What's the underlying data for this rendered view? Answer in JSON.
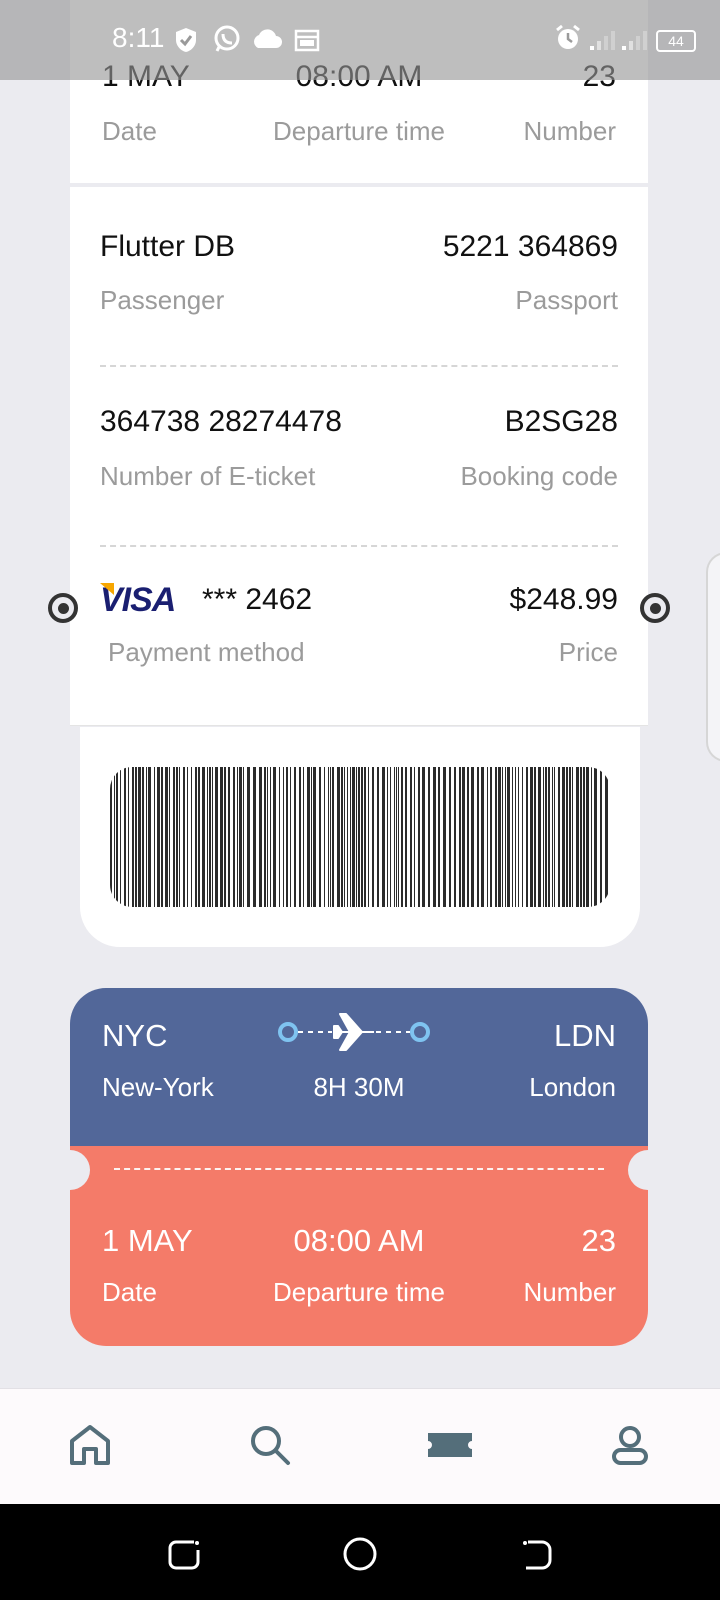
{
  "status_bar": {
    "time": "8:11",
    "battery": "44"
  },
  "top_ticket": {
    "date": "1 MAY",
    "date_label": "Date",
    "departure": "08:00 AM",
    "departure_label": "Departure time",
    "number": "23",
    "number_label": "Number"
  },
  "details": {
    "passenger": "Flutter DB",
    "passenger_label": "Passenger",
    "passport": "5221 364869",
    "passport_label": "Passport",
    "eticket": "364738 28274478",
    "eticket_label": "Number of E-ticket",
    "booking": "B2SG28",
    "booking_label": "Booking code",
    "visa_logo": "VISA",
    "card": "*** 2462",
    "payment_label": "Payment method",
    "price": "$248.99",
    "price_label": "Price"
  },
  "ticket": {
    "from_code": "NYC",
    "from_city": "New-York",
    "to_code": "LDN",
    "to_city": "London",
    "duration": "8H 30M",
    "date": "1 MAY",
    "date_label": "Date",
    "departure": "08:00 AM",
    "departure_label": "Departure time",
    "number": "23",
    "number_label": "Number"
  },
  "nav": [
    "home-icon",
    "search-icon",
    "ticket-icon",
    "profile-icon"
  ],
  "colors": {
    "ticket_top": "#526799",
    "ticket_bottom": "#f47b69",
    "nav_icon": "#546e7a",
    "visa_blue": "#1a1f71",
    "visa_gold": "#f7a600"
  }
}
